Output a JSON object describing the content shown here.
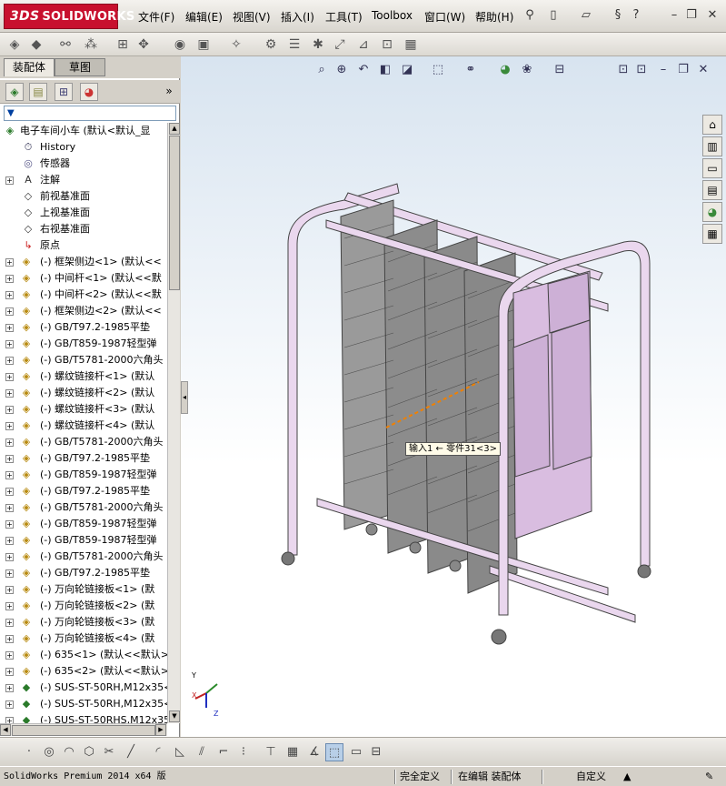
{
  "app": {
    "logo_prefix": "3DS",
    "logo_text": "SOLIDWORKS"
  },
  "menu": [
    "文件(F)",
    "编辑(E)",
    "视图(V)",
    "插入(I)",
    "工具(T)",
    "Toolbox",
    "窗口(W)",
    "帮助(H)"
  ],
  "panel": {
    "tabs": [
      "装配体",
      "草图"
    ],
    "filter_icon": "filter-icon",
    "root": "电子车间小车  (默认<默认_显",
    "items": [
      {
        "label": "History",
        "icon": "history-icon",
        "expand": false
      },
      {
        "label": "传感器",
        "icon": "sensor-icon",
        "expand": false
      },
      {
        "label": "注解",
        "icon": "annotation-icon",
        "expand": true
      },
      {
        "label": "前视基准面",
        "icon": "plane-icon",
        "expand": false
      },
      {
        "label": "上视基准面",
        "icon": "plane-icon",
        "expand": false
      },
      {
        "label": "右视基准面",
        "icon": "plane-icon",
        "expand": false
      },
      {
        "label": "原点",
        "icon": "origin-icon",
        "expand": false
      },
      {
        "label": "(-) 框架侧边<1> (默认<<",
        "icon": "part-icon",
        "expand": true
      },
      {
        "label": "(-) 中间杆<1> (默认<<默",
        "icon": "part-icon",
        "expand": true
      },
      {
        "label": "(-) 中间杆<2> (默认<<默",
        "icon": "part-icon",
        "expand": true
      },
      {
        "label": "(-) 框架侧边<2> (默认<<",
        "icon": "part-icon",
        "expand": true
      },
      {
        "label": "(-) GB/T97.2-1985平垫",
        "icon": "part-icon",
        "expand": true
      },
      {
        "label": "(-) GB/T859-1987轻型弹",
        "icon": "part-icon",
        "expand": true
      },
      {
        "label": "(-) GB/T5781-2000六角头",
        "icon": "part-icon",
        "expand": true
      },
      {
        "label": "(-) 螺纹链接杆<1> (默认",
        "icon": "part-icon",
        "expand": true
      },
      {
        "label": "(-) 螺纹链接杆<2> (默认",
        "icon": "part-icon",
        "expand": true
      },
      {
        "label": "(-) 螺纹链接杆<3> (默认",
        "icon": "part-icon",
        "expand": true
      },
      {
        "label": "(-) 螺纹链接杆<4> (默认",
        "icon": "part-icon",
        "expand": true
      },
      {
        "label": "(-) GB/T5781-2000六角头",
        "icon": "part-icon",
        "expand": true
      },
      {
        "label": "(-) GB/T97.2-1985平垫",
        "icon": "part-icon",
        "expand": true
      },
      {
        "label": "(-) GB/T859-1987轻型弹",
        "icon": "part-icon",
        "expand": true
      },
      {
        "label": "(-) GB/T97.2-1985平垫",
        "icon": "part-icon",
        "expand": true
      },
      {
        "label": "(-) GB/T5781-2000六角头",
        "icon": "part-icon",
        "expand": true
      },
      {
        "label": "(-) GB/T859-1987轻型弹",
        "icon": "part-icon",
        "expand": true
      },
      {
        "label": "(-) GB/T859-1987轻型弹",
        "icon": "part-icon",
        "expand": true
      },
      {
        "label": "(-) GB/T5781-2000六角头",
        "icon": "part-icon",
        "expand": true
      },
      {
        "label": "(-) GB/T97.2-1985平垫",
        "icon": "part-icon",
        "expand": true
      },
      {
        "label": "(-) 万向轮链接板<1> (默",
        "icon": "part-icon",
        "expand": true
      },
      {
        "label": "(-) 万向轮链接板<2> (默",
        "icon": "part-icon",
        "expand": true
      },
      {
        "label": "(-) 万向轮链接板<3> (默",
        "icon": "part-icon",
        "expand": true
      },
      {
        "label": "(-) 万向轮链接板<4> (默",
        "icon": "part-icon",
        "expand": true
      },
      {
        "label": "(-) 635<1> (默认<<默认>",
        "icon": "part-icon",
        "expand": true
      },
      {
        "label": "(-) 635<2> (默认<<默认>",
        "icon": "part-icon",
        "expand": true
      },
      {
        "label": "(-) SUS-ST-50RH,M12x35<",
        "icon": "subassembly-icon",
        "expand": true
      },
      {
        "label": "(-) SUS-ST-50RH,M12x35<",
        "icon": "subassembly-icon",
        "expand": true
      },
      {
        "label": "(-) SUS-ST-50RHS,M12x35",
        "icon": "subassembly-icon",
        "expand": true
      }
    ]
  },
  "viewport": {
    "callout": "输入1 ← 零件31<3>",
    "triad": {
      "x": "X",
      "y": "Y",
      "z": "Z"
    }
  },
  "status": {
    "product": "SolidWorks Premium 2014 x64 版",
    "fully_defined": "完全定义",
    "editing": "在编辑 装配体",
    "custom": "自定义"
  },
  "colors": {
    "logo_red": "#c8102e",
    "frame_pink": "#e8d0ec",
    "rack_dark": "#444444",
    "selection_orange": "#f08000"
  }
}
